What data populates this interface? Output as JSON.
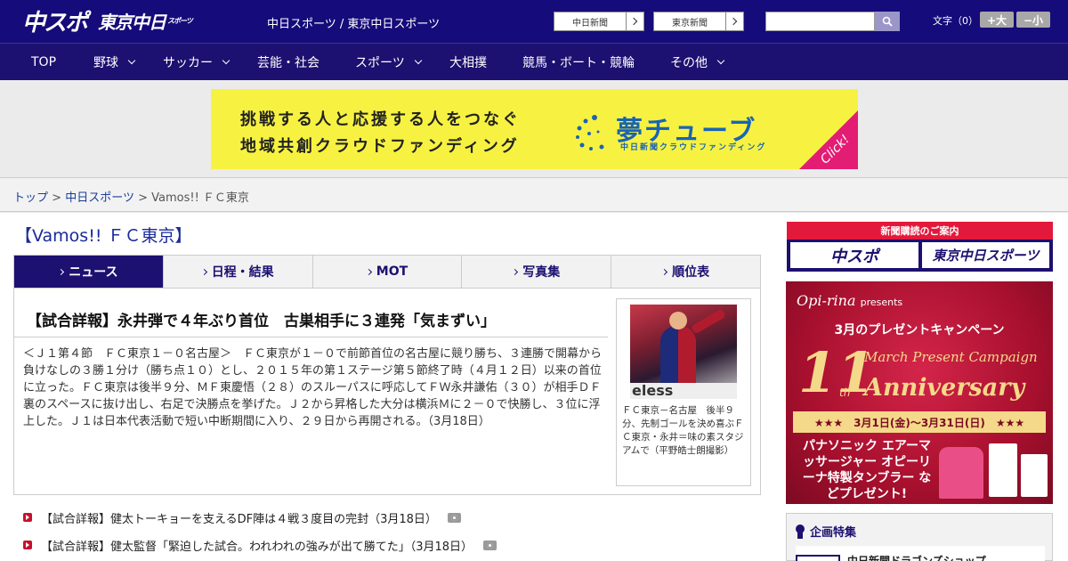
{
  "header": {
    "logo_chuspo": "中スポ",
    "logo_tokyo": "東京中日",
    "logo_tokyo_small": "スポーツ",
    "site_name": "中日スポーツ / 東京中日スポーツ",
    "btn_chunichi": "中日新聞",
    "btn_tokyo": "東京新聞",
    "search_placeholder": "",
    "font_label": "文字（0）",
    "font_plus": "+大",
    "font_minus": "−小"
  },
  "nav": [
    {
      "label": "TOP",
      "dropdown": false
    },
    {
      "label": "野球",
      "dropdown": true
    },
    {
      "label": "サッカー",
      "dropdown": true
    },
    {
      "label": "芸能・社会",
      "dropdown": false
    },
    {
      "label": "スポーツ",
      "dropdown": true
    },
    {
      "label": "大相撲",
      "dropdown": false
    },
    {
      "label": "競馬・ボート・競輪",
      "dropdown": false
    },
    {
      "label": "その他",
      "dropdown": true
    }
  ],
  "ad": {
    "line1": "挑戦する人と応援する人をつなぐ",
    "line2": "地域共創クラウドファンディング",
    "logo": "夢チューブ",
    "sub": "中日新聞クラウドファンディング",
    "click": "Click!",
    "colors": {
      "bg": "#f7f241",
      "accent": "#e31d74",
      "logo": "#1a64b4"
    }
  },
  "breadcrumb": {
    "top": "トップ",
    "sep": ">",
    "chunichi": "中日スポーツ",
    "current": "Vamos!! ＦＣ東京"
  },
  "page_title": "【Vamos!! ＦＣ東京】",
  "tabs": [
    {
      "label": "ニュース",
      "active": true
    },
    {
      "label": "日程・結果",
      "active": false
    },
    {
      "label": "MOT",
      "active": false
    },
    {
      "label": "写真集",
      "active": false
    },
    {
      "label": "順位表",
      "active": false
    }
  ],
  "article": {
    "headline": "【試合詳報】永井弾で４年ぶり首位　古巣相手に３連発「気まずい」",
    "body": "＜Ｊ１第４節　ＦＣ東京１－０名古屋＞　ＦＣ東京が１－０で前節首位の名古屋に競り勝ち、３連勝で開幕から負けなしの３勝１分け（勝ち点１０）とし、２０１５年の第１ステージ第５節終了時（４月１２日）以来の首位に立った。ＦＣ東京は後半９分、ＭＦ東慶悟（２８）のスルーパスに呼応してＦＷ永井謙佑（３０）が相手ＤＦ裏のスペースに抜け出し、右足で決勝点を挙げた。Ｊ２から昇格した大分は横浜Ｍに２－０で快勝し、３位に浮上した。Ｊ１は日本代表活動で短い中断期間に入り、２９日から再開される。（3月18日）",
    "photo_sign": "eless",
    "photo_caption": "ＦＣ東京－名古屋　後半９分、先制ゴールを決め喜ぶＦＣ東京・永井＝味の素スタジアムで（平野皓士朗撮影）"
  },
  "list": [
    {
      "text": "【試合詳報】健太トーキョーを支えるDF陣は４戦３度目の完封（3月18日）",
      "photo": true
    },
    {
      "text": "【試合詳報】健太監督「緊迫した試合。われわれの強みが出て勝てた」（3月18日）",
      "photo": true
    }
  ],
  "sidebar": {
    "sub_head": "新聞購読のご案内",
    "sub_logo1": "中スポ",
    "sub_logo2": "東京中日スポーツ",
    "campaign": {
      "brand": "Opi-rina",
      "presents": "presents",
      "title": "3月のプレゼントキャンペーン",
      "big": "11",
      "th": "th",
      "mpc": "March Present Campaign",
      "anniv": "Anniversary",
      "date": "★★★　3月1日(金)〜3月31日(日)　★★★",
      "prize": "パナソニック エアーマッサージャー オピーリーナ特製タンブラー などプレゼント!"
    },
    "feature_title": "企画特集",
    "feature_item": "中日新聞ドラゴンズショップ"
  }
}
